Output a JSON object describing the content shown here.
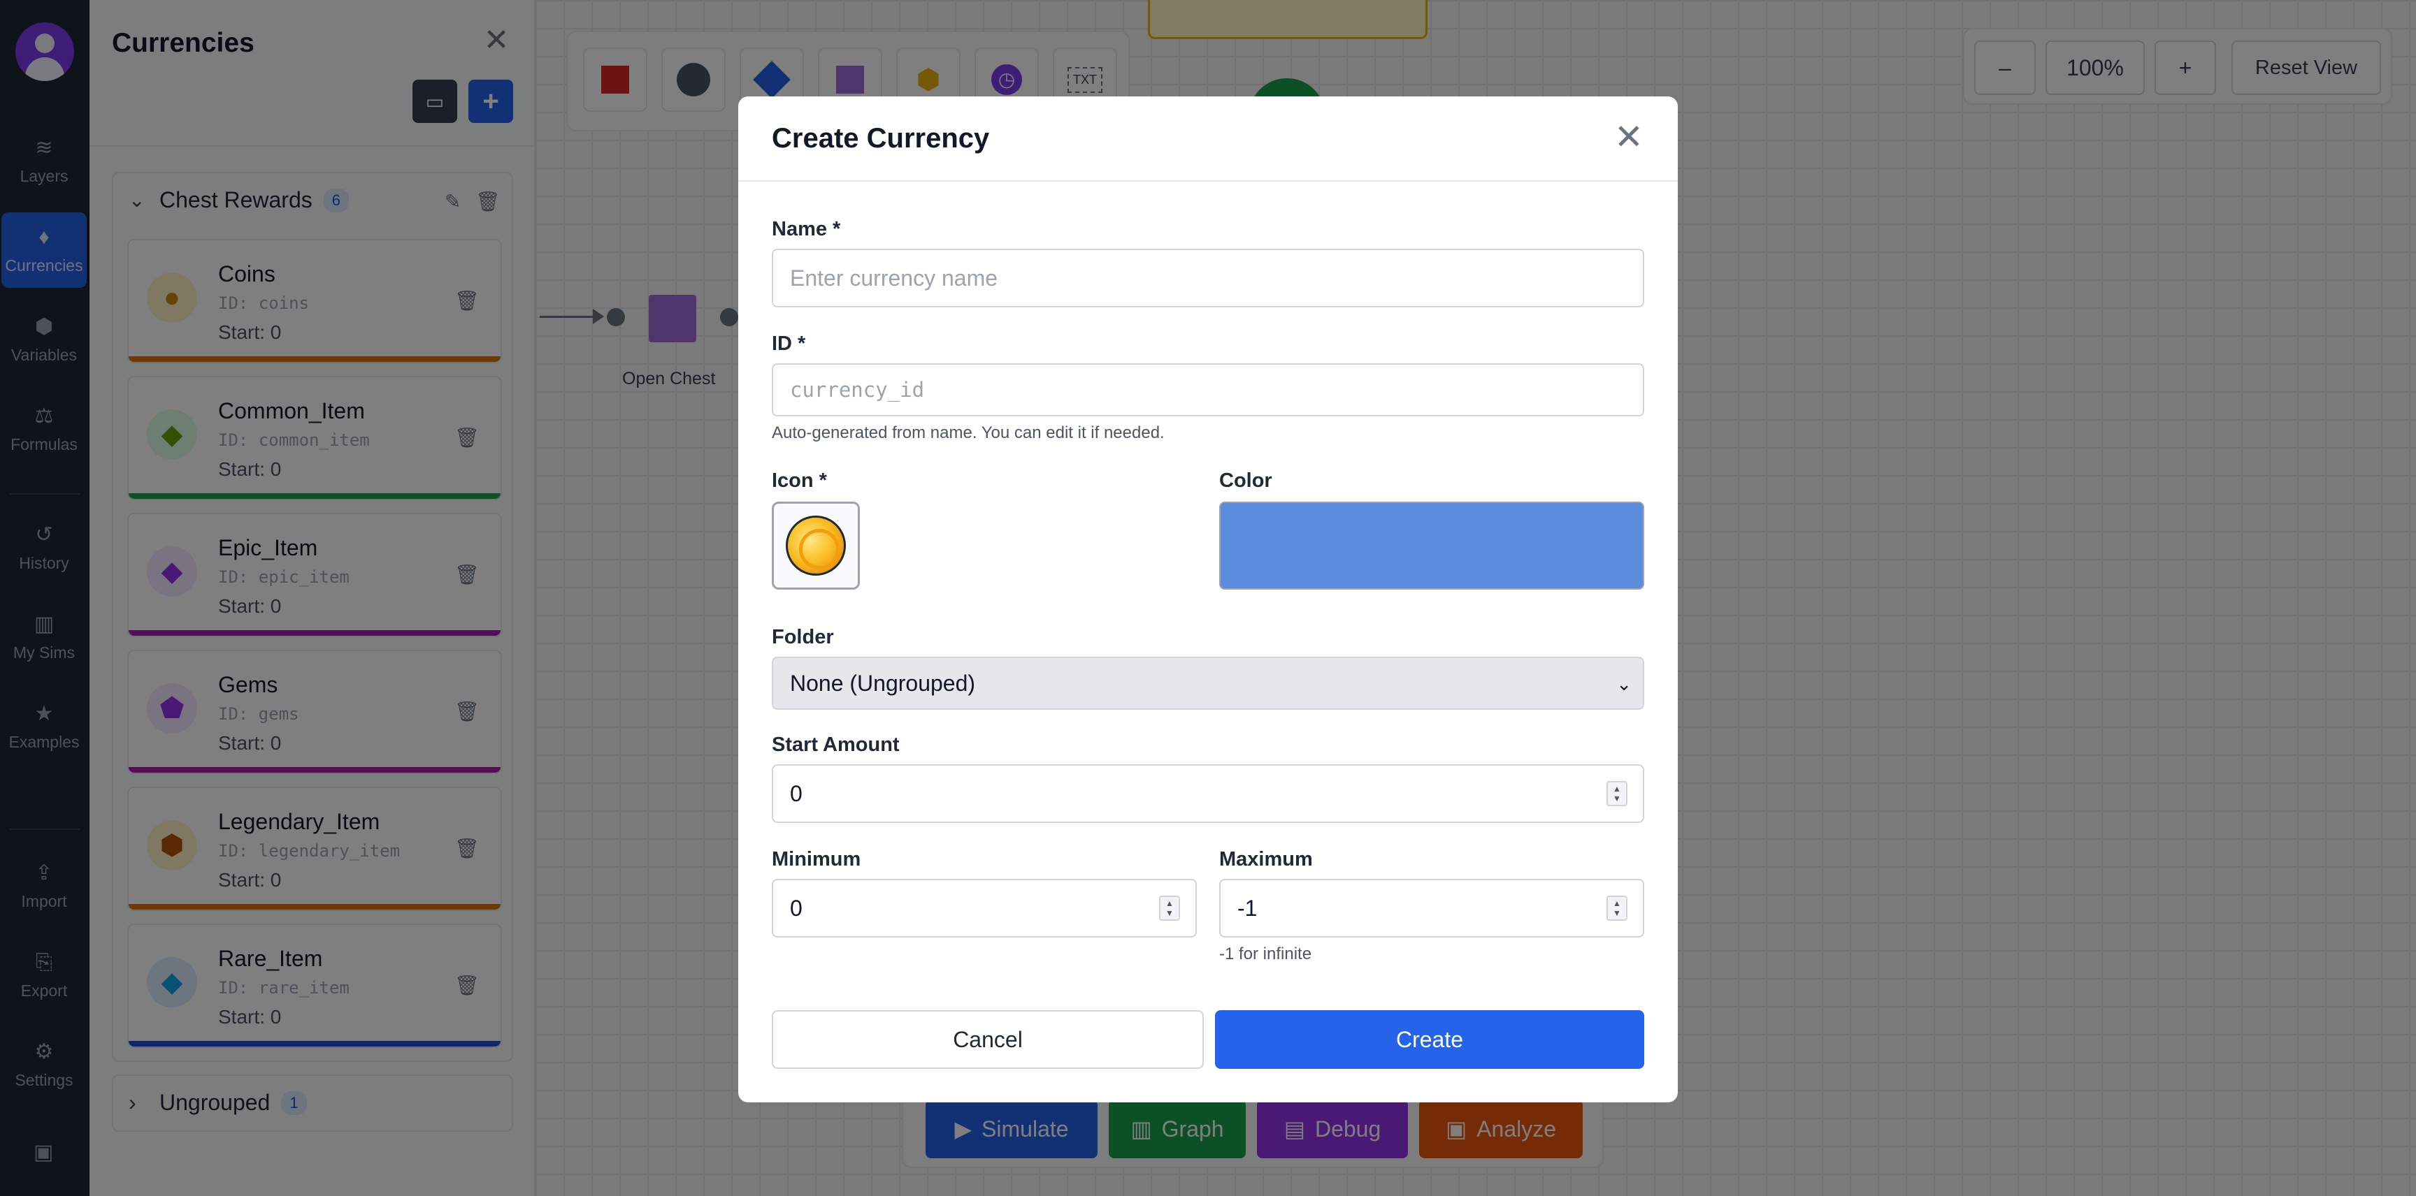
{
  "rail": {
    "items": [
      {
        "label": "Layers",
        "icon": "layers-icon",
        "glyph": "≋"
      },
      {
        "label": "Currencies",
        "icon": "gem-icon",
        "glyph": "♦",
        "active": true
      },
      {
        "label": "Variables",
        "icon": "cube-icon",
        "glyph": "⬢"
      },
      {
        "label": "Formulas",
        "icon": "scale-icon",
        "glyph": "⚖"
      },
      {
        "label": "History",
        "icon": "history-icon",
        "glyph": "↺"
      },
      {
        "label": "My Sims",
        "icon": "map-icon",
        "glyph": "▥"
      },
      {
        "label": "Examples",
        "icon": "star-icon",
        "glyph": "★"
      },
      {
        "label": "Import",
        "icon": "upload-icon",
        "glyph": "⇪"
      },
      {
        "label": "Export",
        "icon": "file-export-icon",
        "glyph": "⎘"
      },
      {
        "label": "Settings",
        "icon": "gear-icon",
        "glyph": "⚙"
      }
    ],
    "save_glyph": "▣"
  },
  "panel": {
    "title": "Currencies",
    "close_glyph": "✕",
    "folder_glyph": "▭",
    "add_glyph": "+",
    "group": {
      "name": "Chest Rewards",
      "count": "6",
      "chev": "⌄",
      "edit_glyph": "✎",
      "del_glyph": "🗑",
      "items": [
        {
          "name": "Coins",
          "id": "ID: coins",
          "start": "Start: 0",
          "color": "#d97706",
          "icon_bg": "#fef3c7",
          "glyph": "●",
          "glyph_color": "#ca8a04"
        },
        {
          "name": "Common_Item",
          "id": "ID: common_item",
          "start": "Start: 0",
          "color": "#16a34a",
          "icon_bg": "#dcfce7",
          "glyph": "◆",
          "glyph_color": "#65a30d"
        },
        {
          "name": "Epic_Item",
          "id": "ID: epic_item",
          "start": "Start: 0",
          "color": "#a21caf",
          "icon_bg": "#f3e8ff",
          "glyph": "◆",
          "glyph_color": "#9333ea"
        },
        {
          "name": "Gems",
          "id": "ID: gems",
          "start": "Start: 0",
          "color": "#a21caf",
          "icon_bg": "#f3e8ff",
          "glyph": "⬟",
          "glyph_color": "#9333ea"
        },
        {
          "name": "Legendary_Item",
          "id": "ID: legendary_item",
          "start": "Start: 0",
          "color": "#d97706",
          "icon_bg": "#fef3c7",
          "glyph": "⬢",
          "glyph_color": "#b45309"
        },
        {
          "name": "Rare_Item",
          "id": "ID: rare_item",
          "start": "Start: 0",
          "color": "#1d4ed8",
          "icon_bg": "#dbeafe",
          "glyph": "◆",
          "glyph_color": "#0ea5e9"
        }
      ]
    },
    "ungrouped": {
      "name": "Ungrouped",
      "count": "1",
      "chev": "›"
    }
  },
  "canvas": {
    "node_label": "Open Chest",
    "zoom": {
      "minus": "–",
      "level": "100%",
      "plus": "+",
      "reset": "Reset View"
    },
    "tools": [
      {
        "name": "square-tool",
        "color": "#dc2626"
      },
      {
        "name": "circle-tool",
        "color": "#4b5563"
      },
      {
        "name": "diamond-tool",
        "color": "#2563eb"
      },
      {
        "name": "purple-square-tool",
        "color": "#9b6cd9"
      },
      {
        "name": "hexagon-tool",
        "color": "#eab308"
      },
      {
        "name": "clock-tool",
        "color": "#7c3aed"
      },
      {
        "name": "text-tool",
        "color": "#6b7280",
        "text": "TXT"
      }
    ],
    "bottom_buttons": [
      {
        "label": "Simulate",
        "glyph": "▶",
        "color": "#2563eb"
      },
      {
        "label": "Graph",
        "glyph": "▥",
        "color": "#16a34a"
      },
      {
        "label": "Debug",
        "glyph": "▤",
        "color": "#9333ea"
      },
      {
        "label": "Analyze",
        "glyph": "▣",
        "color": "#ea580c"
      }
    ]
  },
  "modal": {
    "title": "Create Currency",
    "close_glyph": "✕",
    "name_label": "Name *",
    "name_placeholder": "Enter currency name",
    "id_label": "ID *",
    "id_placeholder": "currency_id",
    "id_hint": "Auto-generated from name. You can edit it if needed.",
    "icon_label": "Icon *",
    "color_label": "Color",
    "color_value": "#5b8cde",
    "folder_label": "Folder",
    "folder_value": "None (Ungrouped)",
    "start_label": "Start Amount",
    "start_value": "0",
    "min_label": "Minimum",
    "min_value": "0",
    "max_label": "Maximum",
    "max_value": "-1",
    "max_hint": "-1 for infinite",
    "cancel_label": "Cancel",
    "create_label": "Create"
  }
}
